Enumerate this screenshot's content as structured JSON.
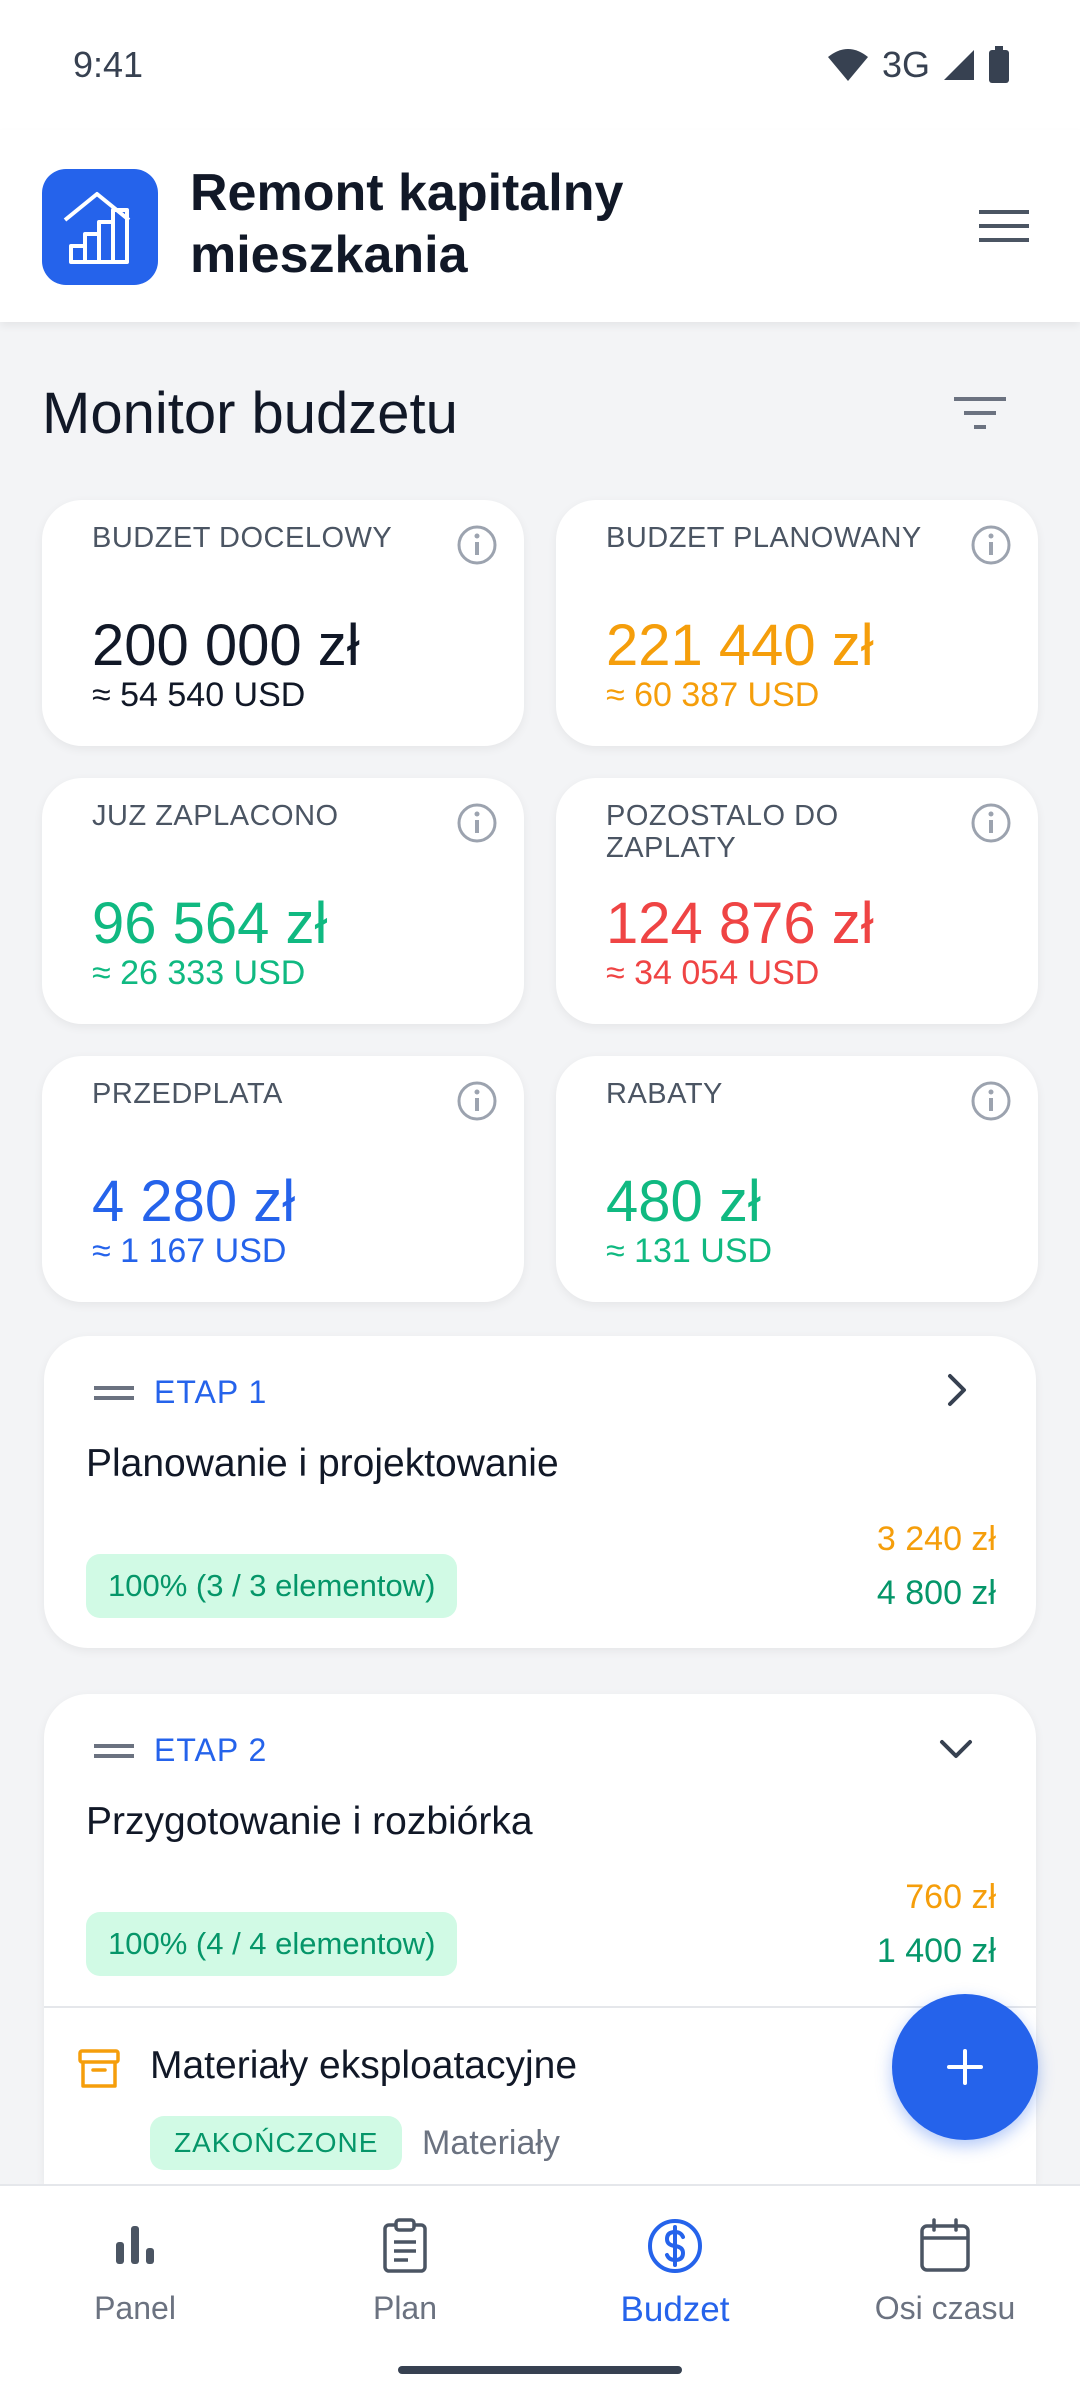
{
  "status_bar": {
    "time": "9:41",
    "network": "3G"
  },
  "header": {
    "title": "Remont kapitalny mieszkania",
    "logo_icon": "stairs-house-icon",
    "menu_icon": "hamburger-menu-icon"
  },
  "budget": {
    "title": "Monitor budzetu",
    "filter_icon": "filter-icon",
    "cards": [
      {
        "label": "BUDZET DOCELOWY",
        "value": "200 000 zł",
        "usd": "≈ 54 540 USD",
        "color": "#111827"
      },
      {
        "label": "BUDZET PLANOWANY",
        "value": "221 440 zł",
        "usd": "≈ 60 387 USD",
        "color": "#f59e0b"
      },
      {
        "label": "JUZ ZAPLACONO",
        "value": "96 564 zł",
        "usd": "≈ 26 333 USD",
        "color": "#10b981"
      },
      {
        "label": "POZOSTALO DO ZAPLATY",
        "value": "124 876 zł",
        "usd": "≈ 34 054 USD",
        "color": "#ef4444"
      },
      {
        "label": "PRZEDPLATA",
        "value": "4 280 zł",
        "usd": "≈ 1 167 USD",
        "color": "#2563eb"
      },
      {
        "label": "RABATY",
        "value": "480 zł",
        "usd": "≈ 131 USD",
        "color": "#10b981"
      }
    ]
  },
  "stages": [
    {
      "number": "ETAP 1",
      "name": "Planowanie i projektowanie",
      "progress": "100% (3 / 3 elementow)",
      "amount_planned": "3 240 zł",
      "amount_target": "4 800 zł",
      "expanded": false
    },
    {
      "number": "ETAP 2",
      "name": "Przygotowanie i rozbiórka",
      "progress": "100% (4 / 4 elementow)",
      "amount_planned": "760 zł",
      "amount_target": "1 400 zł",
      "expanded": true,
      "items": [
        {
          "title": "Materiały eksploatacyjne",
          "status": "ZAKOŃCZONE",
          "category": "Materiały"
        }
      ]
    }
  ],
  "fab": {
    "icon": "plus-icon"
  },
  "nav": [
    {
      "label": "Panel",
      "icon": "bar-chart-icon",
      "active": false
    },
    {
      "label": "Plan",
      "icon": "clipboard-icon",
      "active": false
    },
    {
      "label": "Budzet",
      "icon": "dollar-circle-icon",
      "active": true
    },
    {
      "label": "Osi czasu",
      "icon": "calendar-icon",
      "active": false
    }
  ]
}
